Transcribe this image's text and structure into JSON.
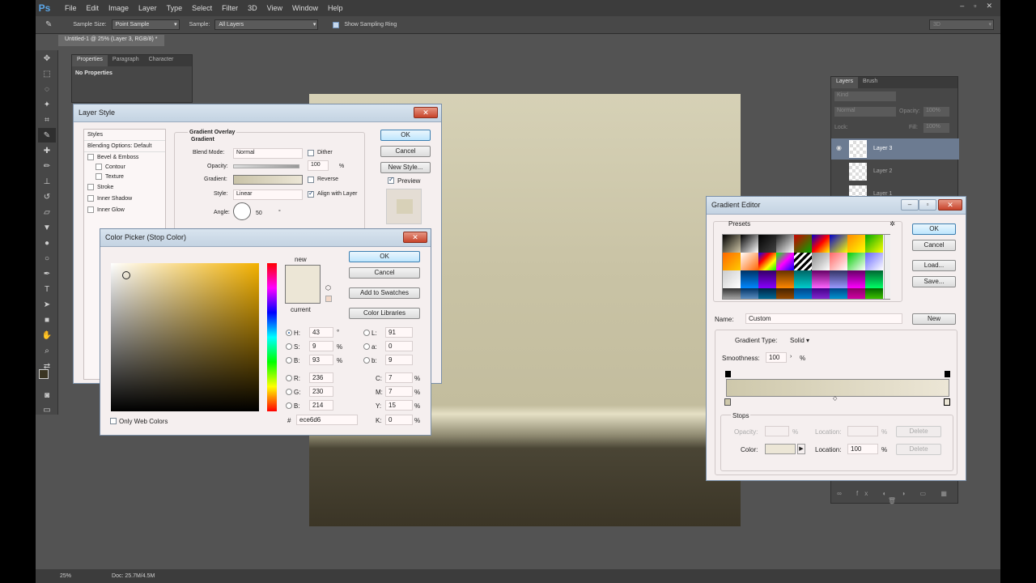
{
  "app": {
    "logo": "Ps",
    "menus": [
      "File",
      "Edit",
      "Image",
      "Layer",
      "Type",
      "Select",
      "Filter",
      "3D",
      "View",
      "Window",
      "Help"
    ],
    "window_buttons": [
      "–",
      "▫",
      "✕"
    ]
  },
  "options_bar": {
    "sample_size_label": "Sample Size:",
    "sample_size_value": "Point Sample",
    "sample_label": "Sample:",
    "sample_value": "All Layers",
    "show_ring_label": "Show Sampling Ring",
    "workspace_value": "3D"
  },
  "document_tab": "Untitled-1 @ 25% (Layer 3, RGB/8) *",
  "properties_panel": {
    "tabs": [
      "Properties",
      "Paragraph",
      "Character"
    ],
    "content": "No Properties"
  },
  "layers_panel": {
    "tabs": [
      "Layers",
      "Brush"
    ],
    "kind_label": "Kind",
    "blend_mode": "Normal",
    "opacity_label": "Opacity:",
    "opacity_value": "100%",
    "lock_label": "Lock:",
    "fill_label": "Fill:",
    "fill_value": "100%",
    "layers": [
      "Layer 3",
      "Layer 2",
      "Layer 1"
    ]
  },
  "status_bar": {
    "zoom": "25%",
    "doc": "Doc: 25.7M/4.5M"
  },
  "layer_style": {
    "title": "Layer Style",
    "styles_header": "Styles",
    "style_items": [
      "Blending Options: Default",
      "Bevel & Emboss",
      "Contour",
      "Texture",
      "Stroke",
      "Inner Shadow",
      "Inner Glow"
    ],
    "section_title": "Gradient Overlay",
    "subsection": "Gradient",
    "blend_mode_label": "Blend Mode:",
    "blend_mode_value": "Normal",
    "dither_label": "Dither",
    "opacity_label": "Opacity:",
    "opacity_value": "100",
    "pct": "%",
    "gradient_label": "Gradient:",
    "reverse_label": "Reverse",
    "style_label": "Style:",
    "style_value": "Linear",
    "align_label": "Align with Layer",
    "angle_label": "Angle:",
    "angle_value": "50",
    "deg": "°",
    "ok": "OK",
    "cancel": "Cancel",
    "new_style": "New Style...",
    "preview_label": "Preview"
  },
  "color_picker": {
    "title": "Color Picker (Stop Color)",
    "new_label": "new",
    "current_label": "current",
    "ok": "OK",
    "cancel": "Cancel",
    "add_swatches": "Add to Swatches",
    "color_libraries": "Color Libraries",
    "only_web_colors": "Only Web Colors",
    "hash": "#",
    "hex": "ece6d6",
    "fields": {
      "H": "43",
      "S": "9",
      "B": "93",
      "R": "236",
      "G": "230",
      "Bv": "214",
      "L": "91",
      "a": "0",
      "b": "9",
      "C": "7",
      "M": "7",
      "Y": "15",
      "K": "0"
    },
    "units": {
      "deg": "°",
      "pct": "%"
    },
    "new_color": "#ece6d6",
    "current_color": "#ece6d6"
  },
  "gradient_editor": {
    "title": "Gradient Editor",
    "presets_label": "Presets",
    "ok": "OK",
    "cancel": "Cancel",
    "load": "Load...",
    "save": "Save...",
    "name_label": "Name:",
    "name_value": "Custom",
    "new_button": "New",
    "gradient_type_label": "Gradient Type:",
    "gradient_type_value": "Solid",
    "smoothness_label": "Smoothness:",
    "smoothness_value": "100",
    "pct": "%",
    "stops_label": "Stops",
    "opacity_label": "Opacity:",
    "location_label": "Location:",
    "delete": "Delete",
    "color_label": "Color:",
    "color_location_value": "100",
    "stop_color": "#ece6d6"
  }
}
